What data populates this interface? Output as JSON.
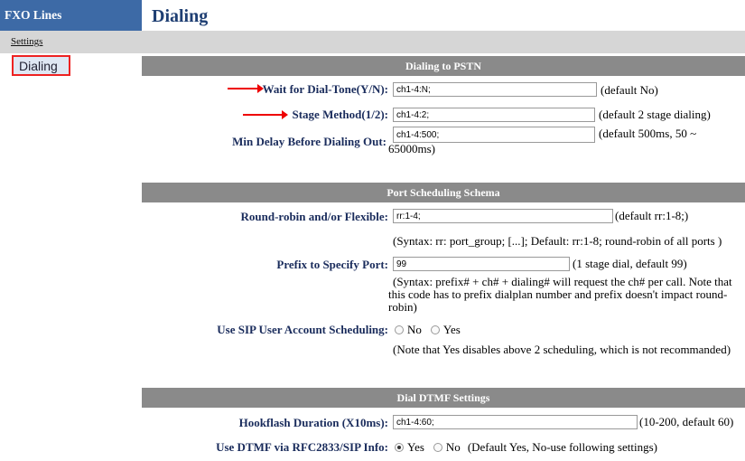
{
  "sidebar": {
    "header": "FXO Lines",
    "settings_link": "Settings",
    "active_item": "Dialing"
  },
  "page": {
    "title": "Dialing"
  },
  "sections": {
    "pstn": {
      "header": "Dialing to PSTN",
      "wait_label": "Wait for Dial-Tone(Y/N):",
      "wait_value": "ch1-4:N;",
      "wait_note": "(default No)",
      "stage_label": "Stage Method(1/2):",
      "stage_value": "ch1-4:2;",
      "stage_note": "(default 2 stage dialing)",
      "delay_label": "Min Delay Before Dialing Out:",
      "delay_value": "ch1-4:500;",
      "delay_note_1": "(default 500ms, 50 ~",
      "delay_note_2": "65000ms)"
    },
    "port": {
      "header": "Port Scheduling Schema",
      "rr_label": "Round-robin and/or Flexible:",
      "rr_value": "rr:1-4;",
      "rr_note": "(default rr:1-8;)",
      "rr_syntax": "(Syntax: rr: port_group; [...]; Default: rr:1-8; round-robin of all ports )",
      "prefix_label": "Prefix to Specify Port:",
      "prefix_value": "99",
      "prefix_note": "(1 stage dial, default 99)",
      "prefix_syntax_1": "(Syntax: prefix# + ch# + dialing# will request the ch# per call. Note that",
      "prefix_syntax_2": "this code has to prefix dialplan number and prefix doesn't impact round-",
      "prefix_syntax_3": "robin)",
      "sip_label": "Use SIP User Account Scheduling:",
      "sip_no": "No",
      "sip_yes": "Yes",
      "sip_note": "(Note that Yes disables above 2 scheduling, which is not recommanded)"
    },
    "dtmf": {
      "header": "Dial DTMF Settings",
      "hook_label": "Hookflash Duration (X10ms):",
      "hook_value": "ch1-4:60;",
      "hook_note": "(10-200, default 60)",
      "rfc_label": "Use DTMF via RFC2833/SIP Info:",
      "rfc_yes": "Yes",
      "rfc_no": "No",
      "rfc_note": "(Default Yes, No-use following settings)"
    }
  },
  "colors": {
    "sidebar_header": "#3d6aa6",
    "section_header": "#8a8a8a",
    "label": "#1a2c5c",
    "highlight": "#e22"
  }
}
